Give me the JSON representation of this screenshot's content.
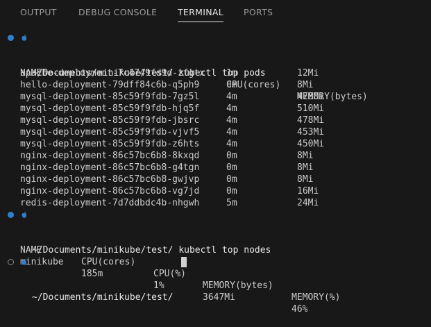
{
  "tabs": [
    {
      "label": "OUTPUT"
    },
    {
      "label": "DEBUG CONSOLE"
    },
    {
      "label": "TERMINAL"
    },
    {
      "label": "PORTS"
    }
  ],
  "active_tab": "TERMINAL",
  "icons": {
    "prompt": "apple-logo-icon",
    "success_marker": "command-success-dot-icon",
    "idle_marker": "command-idle-circle-icon"
  },
  "colors": {
    "background": "#181818",
    "success_dot": "#2f7fd1",
    "text": "#cccccc"
  },
  "terminal": {
    "commands": [
      {
        "prompt": "~/Documents/minikube/test/",
        "command": "kubectl top pods"
      },
      {
        "prompt": "~/Documents/minikube/test/",
        "command": "kubectl top nodes"
      },
      {
        "prompt": "~/Documents/minikube/test/",
        "command": ""
      }
    ],
    "pods": {
      "headers": [
        "NAME",
        "CPU(cores)",
        "MEMORY(bytes)"
      ],
      "rows": [
        [
          "apache-deployment-7c4749fd9d-zfgtx",
          "1m",
          "12Mi"
        ],
        [
          "hello-deployment-79dff84c6b-q5ph9",
          "0m",
          "8Mi"
        ],
        [
          "mysql-deployment-85c59f9fdb-7gz5l",
          "4m",
          "478Mi"
        ],
        [
          "mysql-deployment-85c59f9fdb-hjq5f",
          "4m",
          "510Mi"
        ],
        [
          "mysql-deployment-85c59f9fdb-jbsrc",
          "4m",
          "478Mi"
        ],
        [
          "mysql-deployment-85c59f9fdb-vjvf5",
          "4m",
          "453Mi"
        ],
        [
          "mysql-deployment-85c59f9fdb-z6hts",
          "4m",
          "450Mi"
        ],
        [
          "nginx-deployment-86c57bc6b8-8kxqd",
          "0m",
          "8Mi"
        ],
        [
          "nginx-deployment-86c57bc6b8-g4tgn",
          "0m",
          "8Mi"
        ],
        [
          "nginx-deployment-86c57bc6b8-gwjvp",
          "0m",
          "8Mi"
        ],
        [
          "nginx-deployment-86c57bc6b8-vg7jd",
          "0m",
          "16Mi"
        ],
        [
          "redis-deployment-7d7ddbdc4b-nhgwh",
          "5m",
          "24Mi"
        ]
      ]
    },
    "nodes": {
      "headers": [
        "NAME",
        "CPU(cores)",
        "CPU(%)",
        "MEMORY(bytes)",
        "MEMORY(%)"
      ],
      "rows": [
        [
          "minikube",
          "185m",
          "1%",
          "3647Mi",
          "46%"
        ]
      ]
    }
  }
}
